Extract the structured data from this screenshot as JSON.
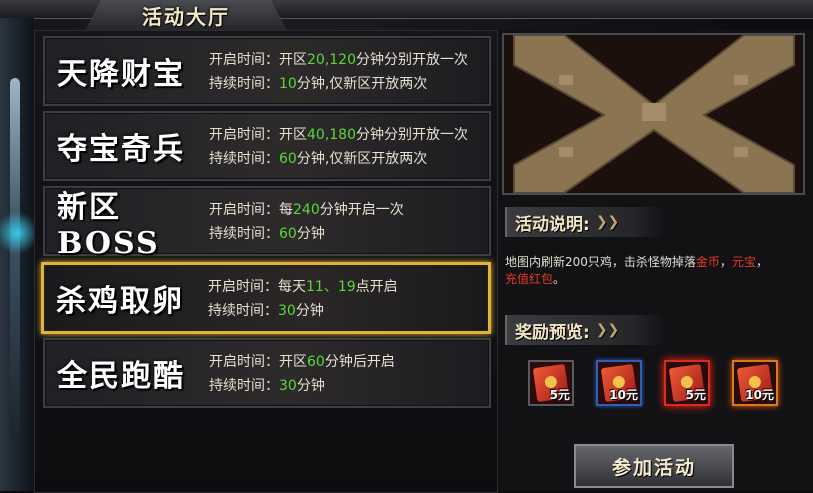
{
  "window": {
    "title": "活动大厅"
  },
  "events": [
    {
      "name": "天降财宝",
      "l1": {
        "label": "开启时间：",
        "pre": "开区",
        "val": "20,120",
        "post": "分钟分别开放一次"
      },
      "l2": {
        "label": "持续时间：",
        "val": "10",
        "post": "分钟,仅新区开放两次"
      }
    },
    {
      "name": "夺宝奇兵",
      "l1": {
        "label": "开启时间：",
        "pre": "开区",
        "val": "40,180",
        "post": "分钟分别开放一次"
      },
      "l2": {
        "label": "持续时间：",
        "val": "60",
        "post": "分钟,仅新区开放两次"
      }
    },
    {
      "name": "新区BOSS",
      "l1": {
        "label": "开启时间：",
        "pre": "每",
        "val": "240",
        "post": "分钟开启一次"
      },
      "l2": {
        "label": "持续时间：",
        "val": "60",
        "post": "分钟"
      }
    },
    {
      "name": "杀鸡取卵",
      "l1": {
        "label": "开启时间：",
        "pre": "每天",
        "val": "11、19",
        "post": "点开启"
      },
      "l2": {
        "label": "持续时间：",
        "val": "30",
        "post": "分钟"
      }
    },
    {
      "name": "全民跑酷",
      "l1": {
        "label": "开启时间：",
        "pre": "开区",
        "val": "60",
        "post": "分钟后开启"
      },
      "l2": {
        "label": "持续时间：",
        "val": "30",
        "post": "分钟"
      }
    }
  ],
  "selected_index": 3,
  "description": {
    "title": "活动说明:",
    "text_a": "地图内刷新200只鸡，击杀怪物掉落",
    "red_a": "金币",
    "sep": "，",
    "red_b": "元宝",
    "sep2": "，",
    "red_c": "充值红包",
    "end": "。"
  },
  "rewards": {
    "title": "奖励预览:",
    "items": [
      {
        "amount": "5元",
        "frame": "grey"
      },
      {
        "amount": "10元",
        "frame": "blue"
      },
      {
        "amount": "5元",
        "frame": "red"
      },
      {
        "amount": "10元",
        "frame": "orange"
      }
    ]
  },
  "join_button": "参加活动",
  "colors": {
    "highlight": "#5cd63d",
    "selected_border": "#e0b43a",
    "red_text": "#e83a2a"
  }
}
